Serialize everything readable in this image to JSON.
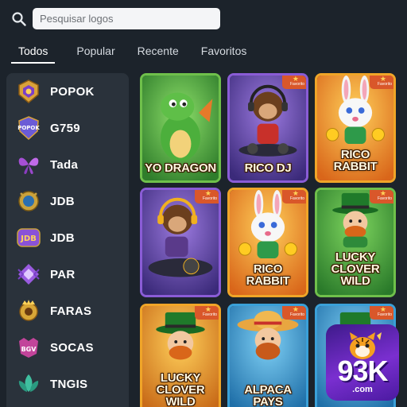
{
  "search": {
    "placeholder": "Pesquisar logos"
  },
  "tabs": [
    {
      "label": "Todos",
      "active": true
    },
    {
      "label": "Popular",
      "active": false
    },
    {
      "label": "Recente",
      "active": false
    },
    {
      "label": "Favoritos",
      "active": false
    }
  ],
  "providers": [
    {
      "label": "POPOK",
      "icon": "popok-logo-icon",
      "color": "#d9a23a"
    },
    {
      "label": "G759",
      "icon": "popok-shield-icon",
      "color": "#6b5bd6",
      "icon_text": "POPOK"
    },
    {
      "label": "Tada",
      "icon": "tada-butterfly-icon",
      "color": "#a64fd6"
    },
    {
      "label": "JDB",
      "icon": "jdb-crest-icon",
      "color": "#caa23c"
    },
    {
      "label": "JDB",
      "icon": "jdb-badge-icon",
      "color": "#8a52d8",
      "icon_text": "JDB"
    },
    {
      "label": "PAR",
      "icon": "par-emblem-icon",
      "color": "#9a5be0"
    },
    {
      "label": "FARAS",
      "icon": "faras-crest-icon",
      "color": "#d8a637"
    },
    {
      "label": "SOCAS",
      "icon": "socas-crest-icon",
      "color": "#c2449a",
      "icon_text": "BGV"
    },
    {
      "label": "TNGIS",
      "icon": "tngis-leaf-icon",
      "color": "#3fbf9f"
    }
  ],
  "games": [
    {
      "title": "YO DRAGON",
      "frame": "#6fc04b",
      "bg1": "#6ec850",
      "bg2": "#2f7d2b",
      "favorite": false,
      "character": "dragon-icon"
    },
    {
      "title": "RICO DJ",
      "frame": "#8a5cd6",
      "bg1": "#7b58c9",
      "bg2": "#3b2a7a",
      "favorite": true,
      "character": "monkey-dj-icon"
    },
    {
      "title": "RICO\nRABBIT",
      "frame": "#f0a528",
      "bg1": "#f5a623",
      "bg2": "#d9661a",
      "favorite": true,
      "character": "rabbit-icon"
    },
    {
      "title": "",
      "frame": "#8a5cd6",
      "bg1": "#7b58c9",
      "bg2": "#3b2a7a",
      "favorite": true,
      "character": "monkey-dj-icon"
    },
    {
      "title": "RICO\nRABBIT",
      "frame": "#f0a528",
      "bg1": "#f5a623",
      "bg2": "#d9661a",
      "favorite": true,
      "character": "rabbit-icon"
    },
    {
      "title": "LUCKY\nCLOVER\nWILD",
      "frame": "#6fc04b",
      "bg1": "#5fbf4b",
      "bg2": "#2a7a2a",
      "favorite": true,
      "character": "leprechaun-icon"
    },
    {
      "title": "LUCKY\nCLOVER\nWILD",
      "frame": "#f0a528",
      "bg1": "#f0a528",
      "bg2": "#c86a18",
      "favorite": true,
      "character": "leprechaun-icon"
    },
    {
      "title": "ALPACA\nPAYS",
      "frame": "#3aa0d8",
      "bg1": "#4ab4e8",
      "bg2": "#1f6fa8",
      "favorite": true,
      "character": "farmer-icon"
    },
    {
      "title": "",
      "frame": "#3aa0d8",
      "bg1": "#4ab4e8",
      "bg2": "#1f6fa8",
      "favorite": true,
      "character": "leprechaun-icon"
    }
  ],
  "favorite_badge": "Favorito",
  "brand": {
    "number": "93K",
    "domain": ".com"
  }
}
